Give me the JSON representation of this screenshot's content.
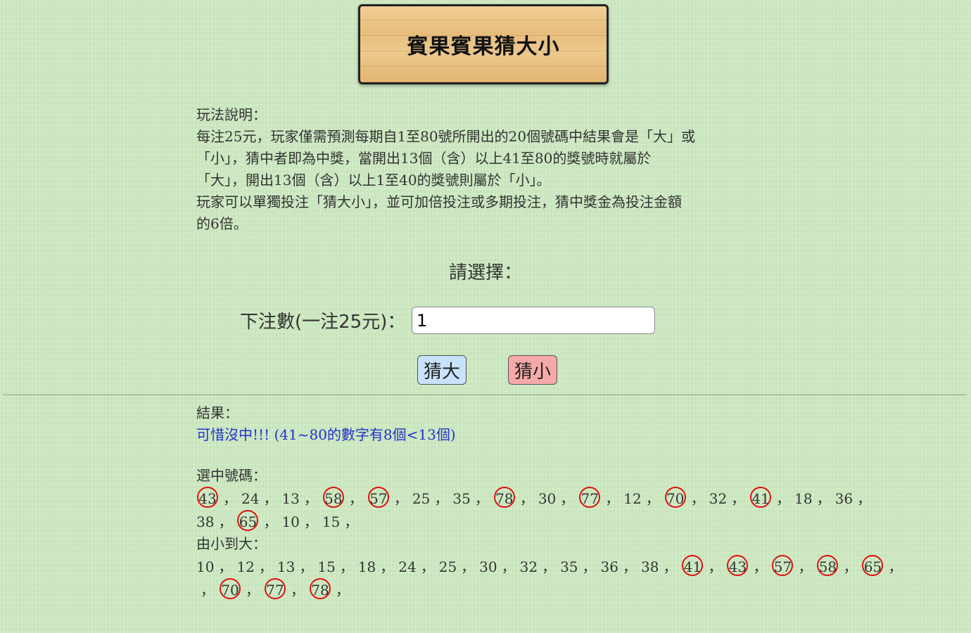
{
  "title": "賓果賓果猜大小",
  "description": {
    "heading": "玩法說明：",
    "line1": "每注25元，玩家僅需預測每期自1至80號所開出的20個號碼中結果會是「大」或",
    "line2": "「小」，猜中者即為中獎，當開出13個（含）以上41至80的獎號時就屬於",
    "line3": "「大」，開出13個（含）以上1至40的獎號則屬於「小」。",
    "line4": "玩家可以單獨投注「猜大小」，並可加倍投注或多期投注，猜中獎金為投注金額",
    "line5": "的6倍。"
  },
  "choose_title": "請選擇：",
  "bet": {
    "label": "下注數(一注25元)：",
    "value": "1"
  },
  "buttons": {
    "big": "猜大",
    "small": "猜小"
  },
  "result": {
    "heading": "結果：",
    "message": "可惜沒中!!! (41~80的數字有8個<13個)",
    "selected_heading": "選中號碼：",
    "sorted_heading": "由小到大：",
    "separator": "，",
    "highlight_color": "#e01010",
    "selected_row1": [
      43,
      24,
      13,
      58,
      57,
      25,
      35,
      78,
      30,
      77,
      12,
      70,
      32,
      41,
      18,
      36
    ],
    "selected_row2": [
      38,
      65,
      10,
      15
    ],
    "sorted_row1": [
      10,
      12,
      13,
      15,
      18,
      24,
      25,
      30,
      32,
      35,
      36,
      38,
      41,
      43,
      57,
      58,
      65
    ],
    "sorted_row2": [
      70,
      77,
      78
    ]
  }
}
